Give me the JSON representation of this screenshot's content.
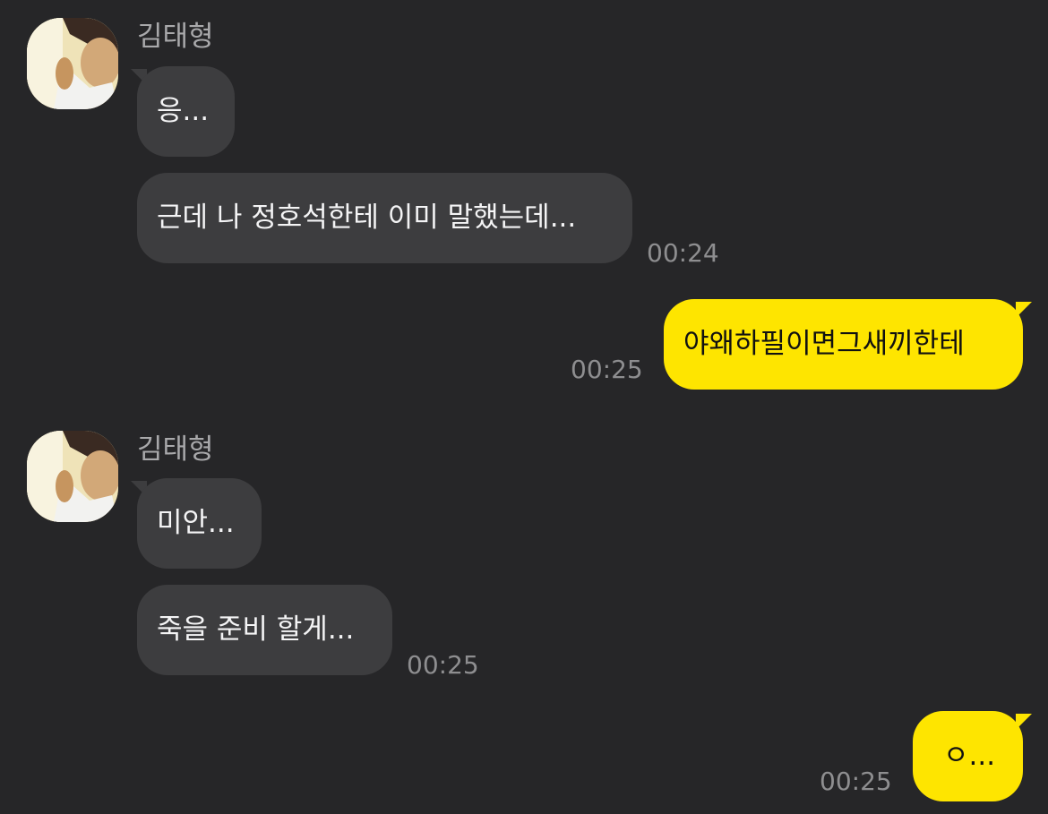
{
  "messages": {
    "group1": {
      "sender": "김태형",
      "bubbles": [
        "응...",
        "근데 나 정호석한테 이미 말했는데..."
      ],
      "time": "00:24"
    },
    "reply1": {
      "text": "야왜하필이면그새끼한테",
      "time": "00:25"
    },
    "group2": {
      "sender": "김태형",
      "bubbles": [
        "미안...",
        "죽을 준비 할게..."
      ],
      "time": "00:25"
    },
    "reply2": {
      "text": "ㅇ...",
      "time": "00:25"
    }
  },
  "colors": {
    "background": "#262628",
    "incoming_bubble": "#3d3d3f",
    "outgoing_bubble": "#fee500",
    "timestamp": "#8e8e90",
    "sender_name": "#a9a9ab"
  },
  "icons": {
    "avatar": "profile-photo"
  }
}
